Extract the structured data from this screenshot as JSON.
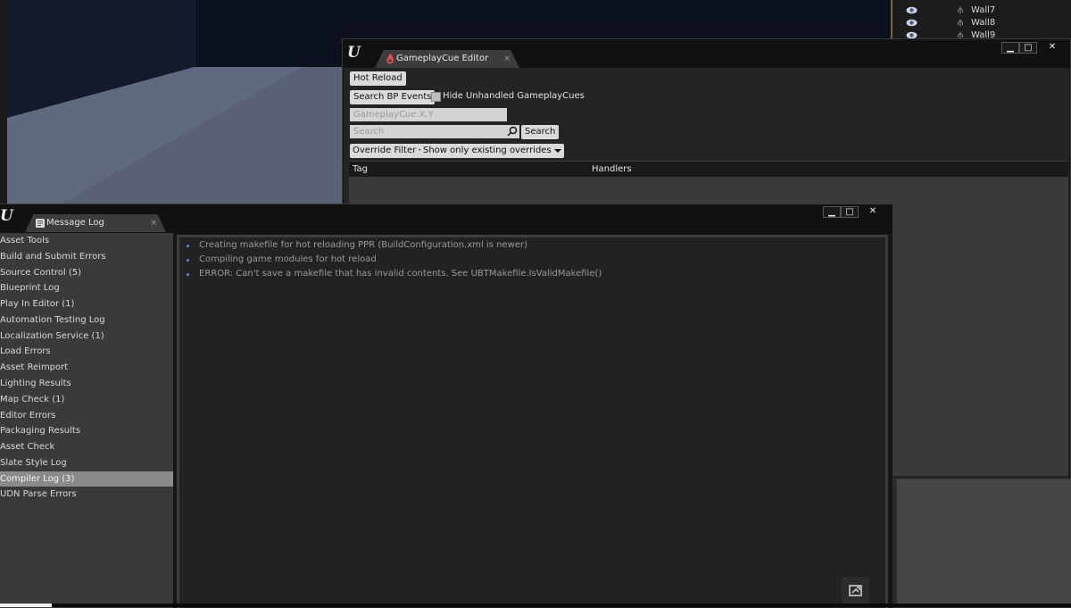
{
  "outliner": {
    "rows": [
      {
        "name": "Wall7"
      },
      {
        "name": "Wall8"
      },
      {
        "name": "Wall9"
      }
    ]
  },
  "gameplaycue_editor": {
    "logo": "U",
    "tab_label": "GameplayCue Editor",
    "tab_close": "×",
    "window_buttons": {
      "minimize": "▁",
      "maximize": "□",
      "close": "✕"
    },
    "hot_reload_label": "Hot Reload",
    "search_bp_events_label": "Search BP Events",
    "hide_unhandled_label": "Hide Unhandled GameplayCues",
    "hide_unhandled_checked": false,
    "new_tag_placeholder": "GameplayCue.X.Y",
    "search_placeholder": "Search",
    "search_button_label": "Search",
    "override_filter_label": "Override Filter",
    "show_overrides_label": "Show only existing overrides",
    "columns": {
      "tag": "Tag",
      "handlers": "Handlers"
    }
  },
  "message_log": {
    "logo": "U",
    "tab_label": "Message Log",
    "tab_close": "×",
    "window_buttons": {
      "minimize": "▁",
      "maximize": "□",
      "close": "✕"
    },
    "categories": [
      {
        "label": "Asset Tools"
      },
      {
        "label": "Build and Submit Errors"
      },
      {
        "label": "Source Control (5)"
      },
      {
        "label": "Blueprint Log"
      },
      {
        "label": "Play In Editor (1)"
      },
      {
        "label": "Automation Testing Log"
      },
      {
        "label": "Localization Service (1)"
      },
      {
        "label": "Load Errors"
      },
      {
        "label": "Asset Reimport"
      },
      {
        "label": "Lighting Results"
      },
      {
        "label": "Map Check (1)"
      },
      {
        "label": "Editor Errors"
      },
      {
        "label": "Packaging Results"
      },
      {
        "label": "Asset Check"
      },
      {
        "label": "Slate Style Log"
      },
      {
        "label": "Compiler Log (3)"
      },
      {
        "label": "UDN Parse Errors"
      }
    ],
    "selected_category": "Compiler Log (3)",
    "messages": [
      {
        "text": "Creating makefile for hot reloading PPR (BuildConfiguration.xml is newer)"
      },
      {
        "text": "Compiling game modules for hot reload"
      },
      {
        "text": "ERROR: Can't save a makefile that has invalid contents.  See UBTMakefile.IsValidMakefile()"
      }
    ],
    "clear_icon": "clear-log-icon"
  },
  "colors": {
    "accent_bullet": "#3b8fe0",
    "selected_row": "#8a8a8a",
    "window_bg": "#222222"
  }
}
